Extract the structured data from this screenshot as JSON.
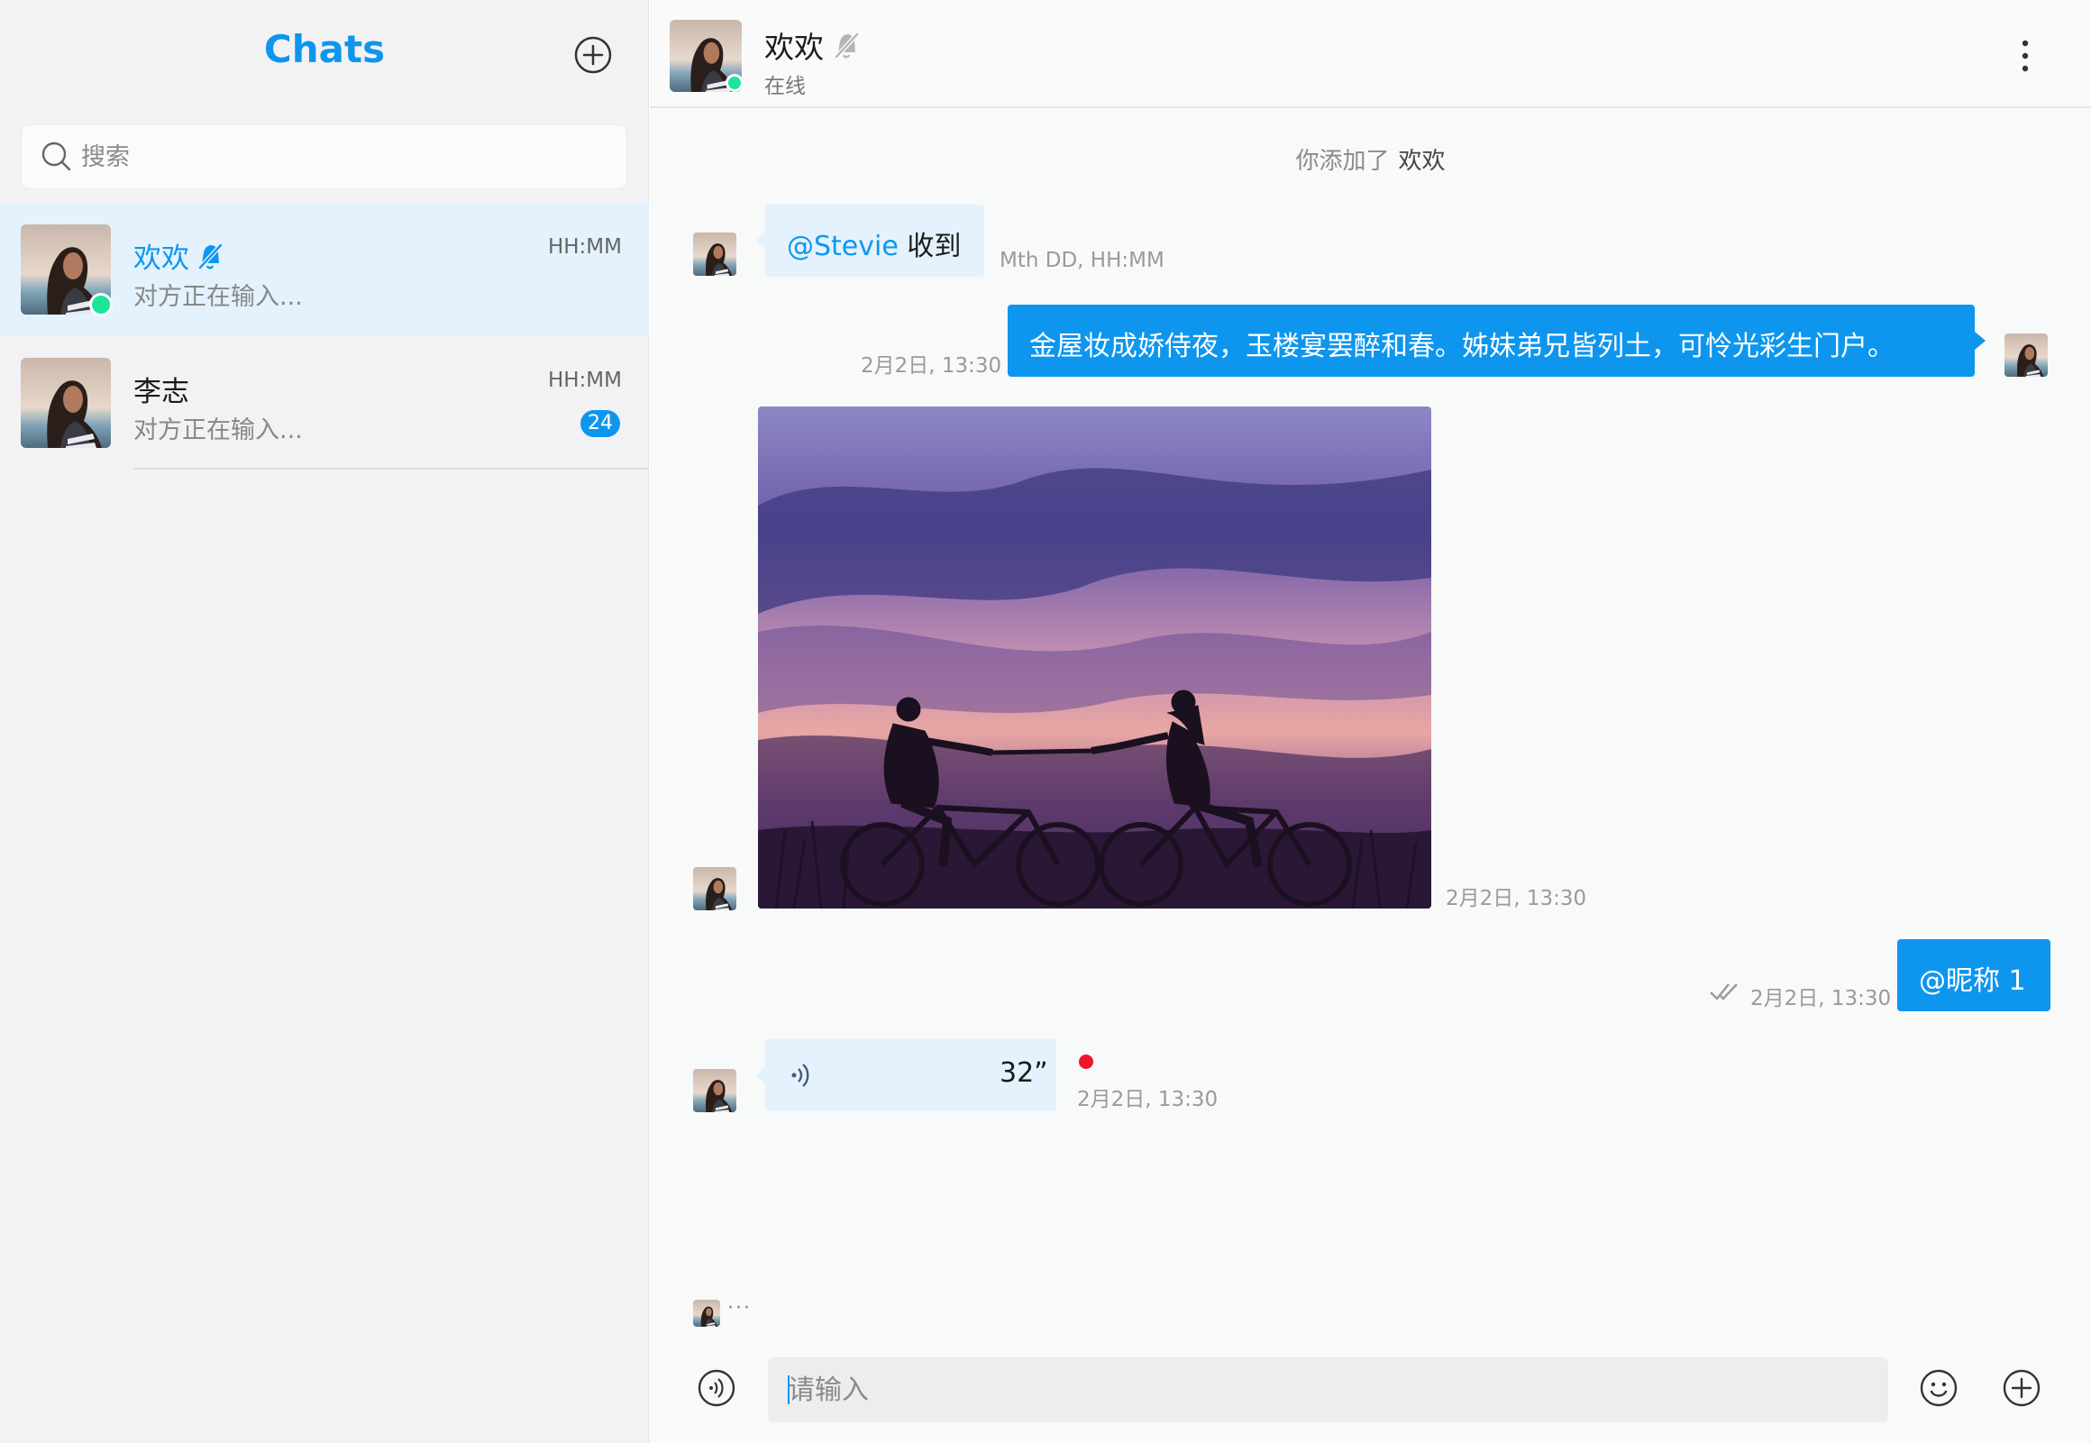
{
  "sidebar": {
    "title": "Chats",
    "search": {
      "placeholder": "搜索",
      "value": ""
    },
    "conversations": [
      {
        "name": "欢欢",
        "time": "HH:MM",
        "preview": "对方正在输入...",
        "online": true,
        "muted": true,
        "unread": ""
      },
      {
        "name": "李志",
        "time": "HH:MM",
        "preview": "对方正在输入...",
        "online": false,
        "muted": false,
        "unread": "24"
      }
    ]
  },
  "header": {
    "name": "欢欢",
    "status": "在线"
  },
  "messages": {
    "system": {
      "text": "你添加了",
      "name": "欢欢"
    },
    "m1": {
      "mention": "@Stevie",
      "text": "收到",
      "time": "Mth DD, HH:MM"
    },
    "m2": {
      "text": "金屋妆成娇侍夜，玉楼宴罢醉和春。姊妹弟兄皆列土，可怜光彩生门户。",
      "time": "2月2日, 13:30"
    },
    "m3": {
      "time": "2月2日, 13:30"
    },
    "m4": {
      "text": "@昵称 1",
      "time": "2月2日, 13:30"
    },
    "m5": {
      "duration": "32”",
      "time": "2月2日, 13:30"
    }
  },
  "typing": {
    "dots": "···"
  },
  "composer": {
    "placeholder": "请输入",
    "value": ""
  },
  "icons": {
    "new_chat": "plus-circle-icon",
    "search": "search-icon",
    "muted": "bell-off-icon",
    "more": "more-vertical-icon",
    "read": "double-check-icon",
    "voice": "voice-wave-icon",
    "emoji": "smile-icon",
    "attach": "plus-circle-icon"
  },
  "colors": {
    "accent": "#0e96ee",
    "online": "#1de49b",
    "unread_dot": "#f0142c",
    "bubble_in": "#e3f2fd"
  }
}
